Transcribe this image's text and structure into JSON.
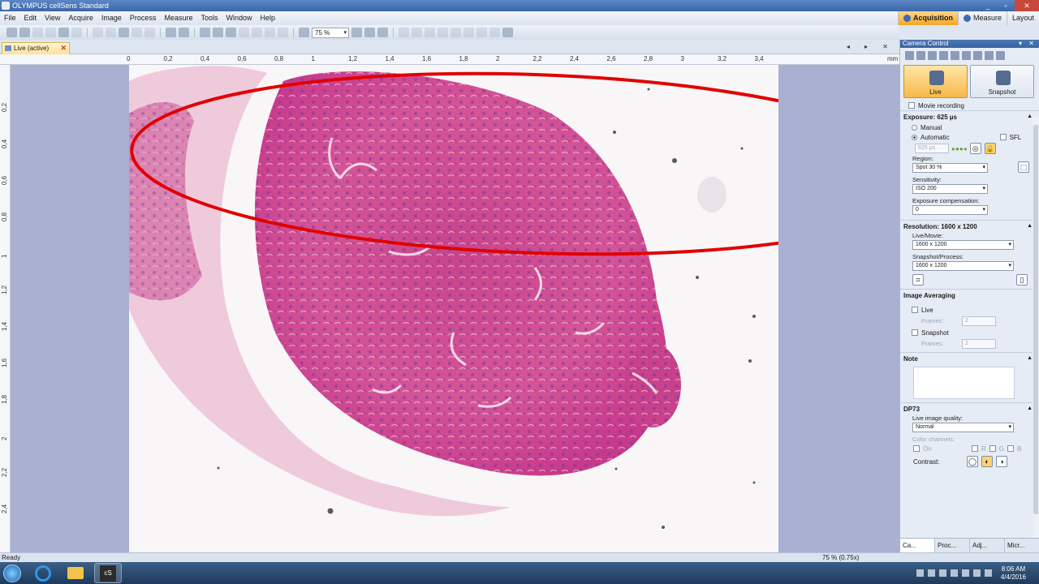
{
  "window": {
    "title": "OLYMPUS cellSens Standard",
    "controls": [
      "_",
      "▫",
      "✕"
    ]
  },
  "menu": [
    "File",
    "Edit",
    "View",
    "Acquire",
    "Image",
    "Process",
    "Measure",
    "Tools",
    "Window",
    "Help"
  ],
  "layout_tabs": [
    {
      "label": "Acquisition",
      "active": true
    },
    {
      "label": "Measure",
      "active": false
    },
    {
      "label": "Layout",
      "active": false
    }
  ],
  "toolbar": {
    "zoom_value": "75 %"
  },
  "document": {
    "tab_label": "Live (active)",
    "close": "✕",
    "nav": "◂ ▸ ✕"
  },
  "ruler": {
    "unit": "mm",
    "top_ticks": [
      "0",
      "0,2",
      "0,4",
      "0,6",
      "0,8",
      "1",
      "1,2",
      "1,4",
      "1,6",
      "1,8",
      "2",
      "2,2",
      "2,4",
      "2,6",
      "2,8",
      "3",
      "3,2",
      "3,4"
    ],
    "left_ticks": [
      "0,2",
      "0,4",
      "0,6",
      "0,8",
      "1",
      "1,2",
      "1,4",
      "1,6",
      "1,8",
      "2",
      "2,2",
      "2,4"
    ]
  },
  "panel": {
    "title": "Camera Control",
    "header_buttons": "▾ ✕",
    "live_label": "Live",
    "snapshot_label": "Snapshot",
    "movie_recording": "Movie recording",
    "exposure": {
      "title": "Exposure: 625 µs",
      "manual": "Manual",
      "automatic": "Automatic",
      "sfl": "SFL",
      "value": "625 µs"
    },
    "region": {
      "label": "Region:",
      "value": "Spot 30 %"
    },
    "sensitivity": {
      "label": "Sensitivity:",
      "value": "ISO 200"
    },
    "exposure_comp": {
      "label": "Exposure compensation:",
      "value": "0"
    },
    "resolution": {
      "title": "Resolution: 1600 x 1200",
      "live_label": "Live/Movie:",
      "live_value": "1600 x 1200",
      "snap_label": "Snapshot/Process:",
      "snap_value": "1600 x 1200"
    },
    "averaging": {
      "title": "Image Averaging",
      "live": "Live",
      "snapshot": "Snapshot",
      "frames_label": "Frames:",
      "frames_value": "2"
    },
    "note": {
      "title": "Note"
    },
    "dp73": {
      "title": "DP73",
      "quality_label": "Live image quality:",
      "quality_value": "Normal",
      "color_label": "Color channels:",
      "on": "On",
      "r": "R",
      "g": "G",
      "b": "B",
      "contrast_label": "Contrast:"
    },
    "bottom_tabs": [
      "Ca...",
      "Proc...",
      "Adj...",
      "Micr..."
    ]
  },
  "status": {
    "text": "Ready",
    "zoom": "75 % (0.75x)"
  },
  "taskbar": {
    "cs_label": "cS",
    "time": "8:06 AM",
    "date": "4/4/2016"
  },
  "colors": {
    "annotation_ellipse": "#e00000",
    "tissue_pink": "#d2468a",
    "accent_orange": "#f5a623"
  }
}
